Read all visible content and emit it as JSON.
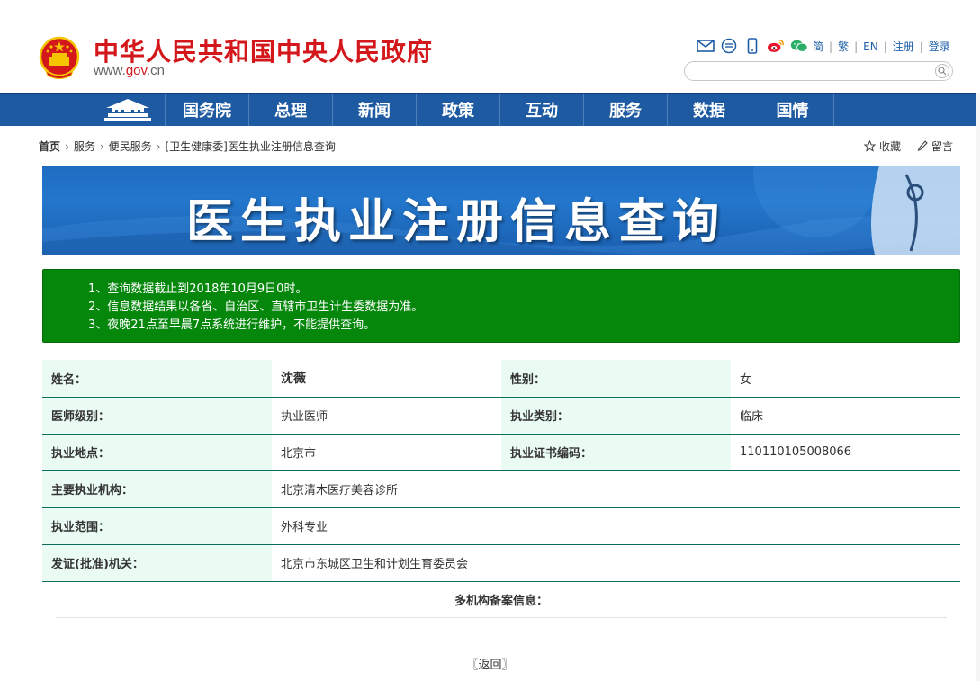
{
  "header": {
    "site_title": "中华人民共和国中央人民政府",
    "site_url_prefix": "www.",
    "site_url_gov": "gov",
    "site_url_suffix": ".cn",
    "icons": [
      "email-icon",
      "message-icon",
      "mobile-icon",
      "weibo-icon",
      "wechat-icon"
    ],
    "links": [
      "简",
      "繁",
      "EN",
      "注册",
      "登录"
    ],
    "search_placeholder": ""
  },
  "nav": {
    "items": [
      "国务院",
      "总理",
      "新闻",
      "政策",
      "互动",
      "服务",
      "数据",
      "国情"
    ]
  },
  "breadcrumb": {
    "items": [
      "首页",
      "服务",
      "便民服务",
      "[卫生健康委]医生执业注册信息查询"
    ]
  },
  "tools": {
    "favorite": "收藏",
    "message": "留言"
  },
  "banner": {
    "title": "医生执业注册信息查询"
  },
  "notice": {
    "lines": [
      "1、查询数据截止到2018年10月9日0时。",
      "2、信息数据结果以各省、自治区、直辖市卫生计生委数据为准。",
      "3、夜晚21点至早晨7点系统进行维护，不能提供查询。"
    ]
  },
  "record": {
    "name_label": "姓名：",
    "name": "沈薇",
    "gender_label": "性别：",
    "gender": "女",
    "level_label": "医师级别：",
    "level": "执业医师",
    "category_label": "执业类别：",
    "category": "临床",
    "location_label": "执业地点：",
    "location": "北京市",
    "cert_label": "执业证书编码：",
    "cert": "110110105008066",
    "org_label": "主要执业机构：",
    "org": "北京清木医疗美容诊所",
    "scope_label": "执业范围：",
    "scope": "外科专业",
    "issuer_label": "发证(批准)机关：",
    "issuer": "北京市东城区卫生和计划生育委员会"
  },
  "multi_org_label": "多机构备案信息：",
  "back_label": "〖返回〗",
  "colors": {
    "brand_red": "#d3171b",
    "nav_blue": "#1d5aa1",
    "notice_green": "#05870b",
    "label_bg": "#eafbf3",
    "table_border": "#0d6e5c"
  }
}
